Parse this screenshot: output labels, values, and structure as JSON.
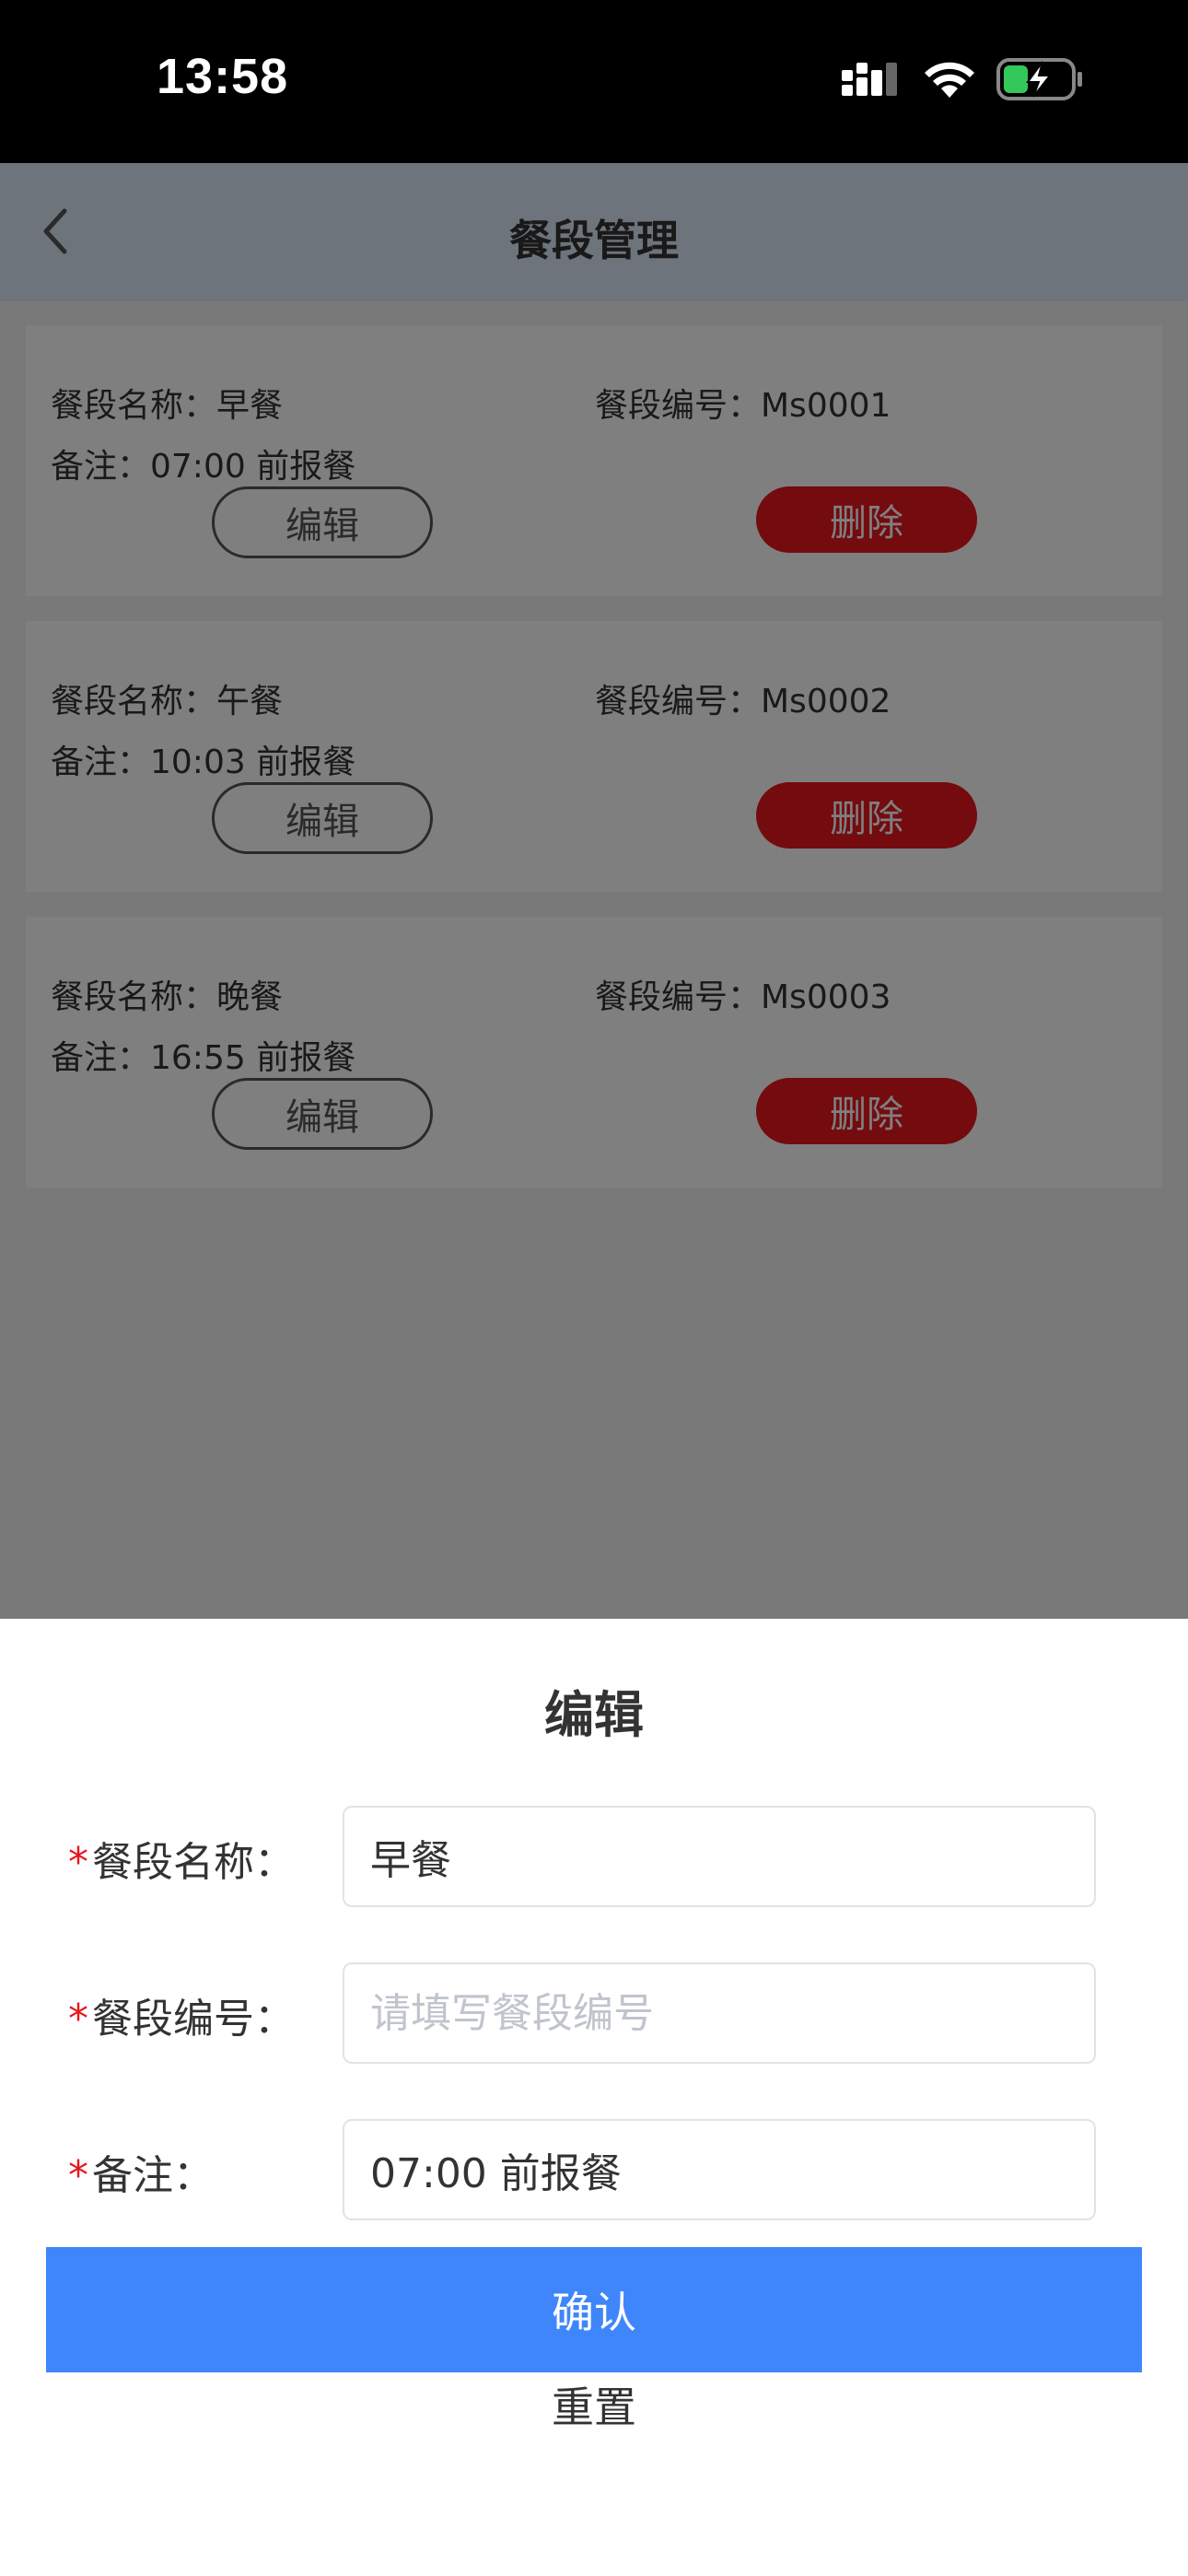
{
  "status_bar": {
    "time": "13:58"
  },
  "header": {
    "title": "餐段管理"
  },
  "list": {
    "items": [
      {
        "name": "餐段名称：早餐",
        "code": "餐段编号：Ms0001",
        "note": "备注：07:00 前报餐",
        "edit_label": "编辑",
        "delete_label": "删除"
      },
      {
        "name": "餐段名称：午餐",
        "code": "餐段编号：Ms0002",
        "note": "备注：10:03 前报餐",
        "edit_label": "编辑",
        "delete_label": "删除"
      },
      {
        "name": "餐段名称：晚餐",
        "code": "餐段编号：Ms0003",
        "note": "备注：16:55 前报餐",
        "edit_label": "编辑",
        "delete_label": "删除"
      }
    ]
  },
  "sheet": {
    "title": "编辑",
    "fields": {
      "name": {
        "label": "餐段名称：",
        "value": "早餐",
        "placeholder": ""
      },
      "code": {
        "label": "餐段编号：",
        "value": "",
        "placeholder": "请填写餐段编号"
      },
      "note": {
        "label": "备注：",
        "value": "07:00 前报餐",
        "placeholder": ""
      }
    },
    "required_mark": "*",
    "confirm_label": "确认",
    "reset_label": "重置"
  },
  "colors": {
    "primary": "#3f86fc",
    "danger": "#e8171d",
    "header_bg": "#dbe8f6"
  }
}
